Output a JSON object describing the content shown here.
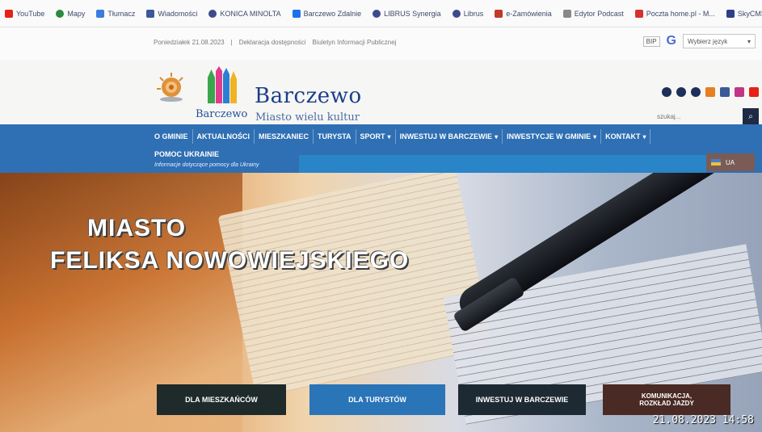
{
  "bookmarks": [
    {
      "label": "YouTube",
      "icon": "youtube-icon",
      "color": "#e62117"
    },
    {
      "label": "Mapy",
      "icon": "map-pin-icon",
      "color": "#2b8a3e"
    },
    {
      "label": "Tłumacz",
      "icon": "translate-icon",
      "color": "#3b7ddd"
    },
    {
      "label": "Wiadomości",
      "icon": "news-icon",
      "color": "#3b5998"
    },
    {
      "label": "KONICA MINOLTA",
      "icon": "globe-icon",
      "color": "#3c4b8c"
    },
    {
      "label": "Barczewo Zdalnie",
      "icon": "triangle-icon",
      "color": "#1a73e8"
    },
    {
      "label": "LIBRUS Synergia",
      "icon": "globe-icon",
      "color": "#3c4b8c"
    },
    {
      "label": "Librus",
      "icon": "globe-icon",
      "color": "#3c4b8c"
    },
    {
      "label": "e-Zamówienia",
      "icon": "flag-icon",
      "color": "#c0392b"
    },
    {
      "label": "Edytor Podcast",
      "icon": "page-icon",
      "color": "#888888"
    },
    {
      "label": "Poczta home.pl - M...",
      "icon": "mail-icon",
      "color": "#d63031"
    },
    {
      "label": "SkyCMS instrukcje",
      "icon": "book-icon",
      "color": "#2d3e8a"
    }
  ],
  "topinfo": {
    "date": "Poniedziałek 21.08.2023",
    "link1": "Deklaracja dostępności",
    "link2": "Biuletyn Informacji Publicznej",
    "bip": "BIP",
    "lang_select": "Wybierz język"
  },
  "header": {
    "logo_caption": "Barczewo",
    "title": "Barczewo",
    "subtitle": "Miasto wielu kultur",
    "search_placeholder": "szukaj..."
  },
  "nav": {
    "items": [
      {
        "label": "O GMINIE",
        "caret": false
      },
      {
        "label": "AKTUALNOŚCI",
        "caret": false
      },
      {
        "label": "MIESZKANIEC",
        "caret": false
      },
      {
        "label": "TURYSTA",
        "caret": false
      },
      {
        "label": "SPORT",
        "caret": true
      },
      {
        "label": "INWESTUJ W BARCZEWIE",
        "caret": true
      },
      {
        "label": "INWESTYCJE W GMINIE",
        "caret": true
      },
      {
        "label": "KONTAKT",
        "caret": true
      }
    ],
    "second_line": "POMOC UKRAINIE",
    "subnote": "Informacje dotyczące pomocy dla Ukrainy",
    "ua_label": "UA"
  },
  "hero": {
    "line1": "MIASTO",
    "line2": "FELIKSA NOWOWIEJSKIEGO",
    "buttons": [
      "DLA MIESZKAŃCÓW",
      "DLA TURYSTÓW",
      "INWESTUJ W BARCZEWIE",
      "KOMUNIKACJA,"
    ],
    "button4_line2": "ROZKŁAD JAZDY"
  },
  "timestamp": "21.08.2023 14:58",
  "colors": {
    "nav_blue": "#2f6fb3",
    "title_blue": "#1b3e8a"
  }
}
